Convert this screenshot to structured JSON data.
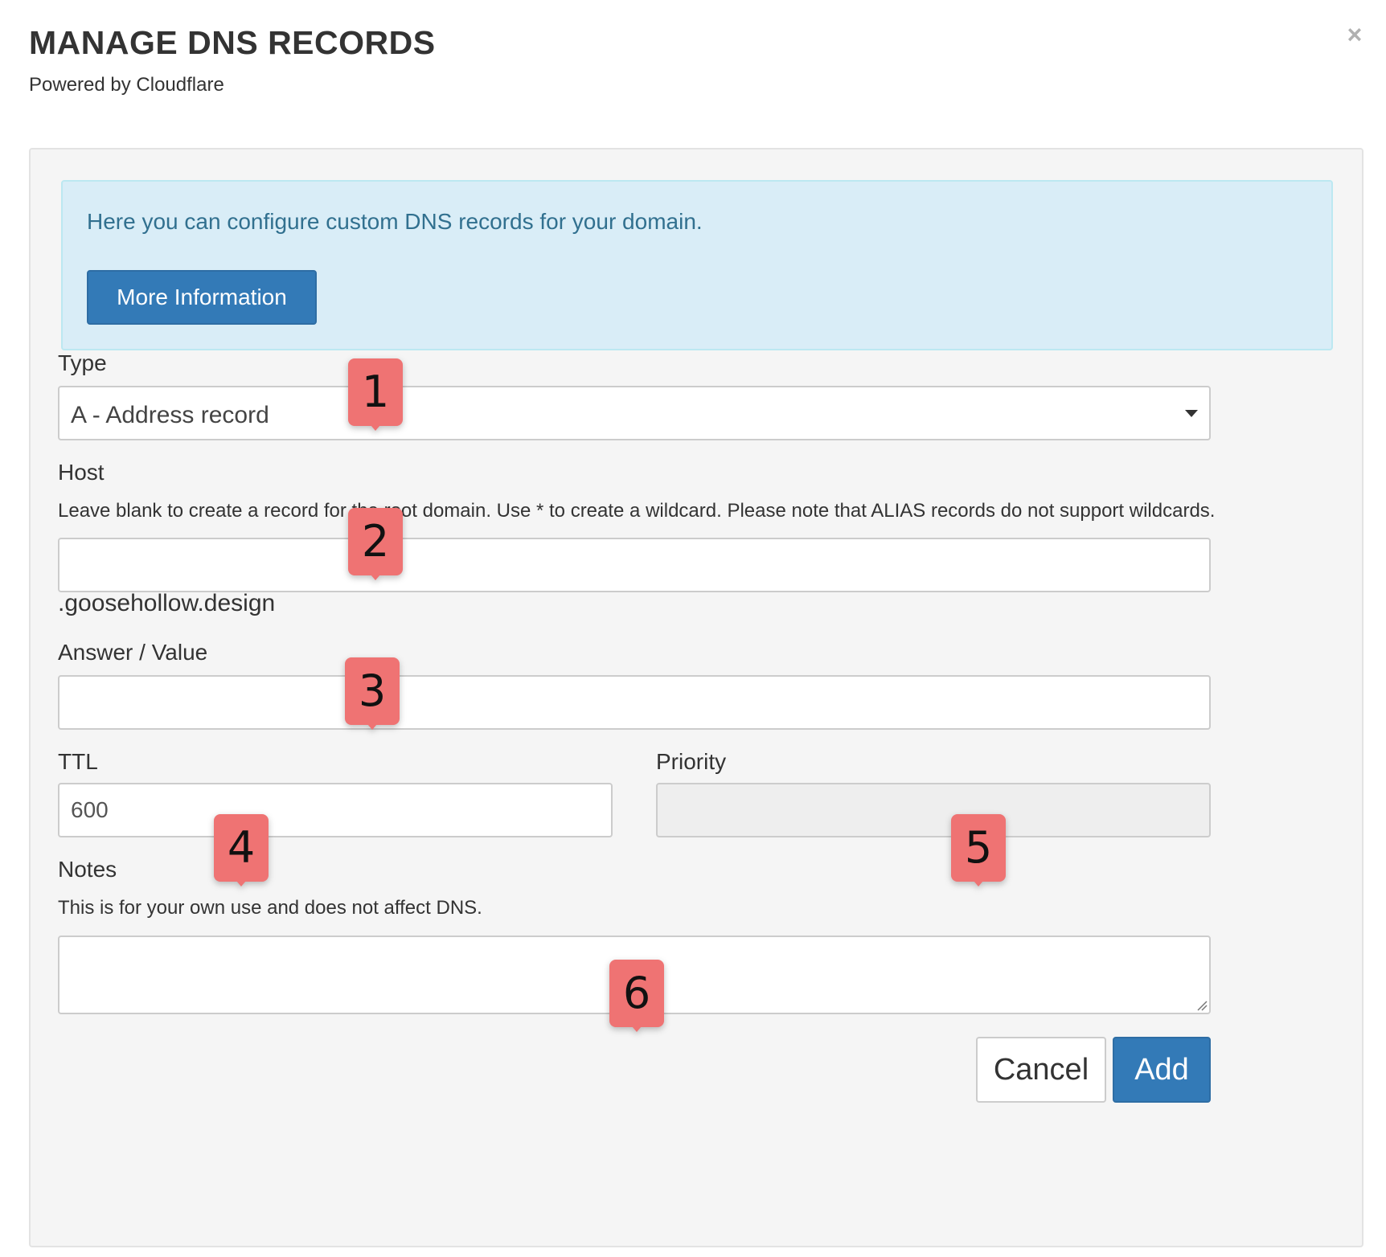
{
  "header": {
    "title": "MANAGE DNS RECORDS",
    "subtitle": "Powered by Cloudflare",
    "close_symbol": "×"
  },
  "info": {
    "text": "Here you can configure custom DNS records for your domain.",
    "button_label": "More Information"
  },
  "form": {
    "type": {
      "label": "Type",
      "selected": "A - Address record"
    },
    "host": {
      "label": "Host",
      "help": "Leave blank to create a record for the root domain. Use * to create a wildcard. Please note that ALIAS records do not support wildcards.",
      "value": "",
      "suffix": ".goosehollow.design"
    },
    "answer": {
      "label": "Answer / Value",
      "value": ""
    },
    "ttl": {
      "label": "TTL",
      "value": "600"
    },
    "priority": {
      "label": "Priority",
      "value": ""
    },
    "notes": {
      "label": "Notes",
      "help": "This is for your own use and does not affect DNS.",
      "value": ""
    }
  },
  "footer": {
    "cancel_label": "Cancel",
    "add_label": "Add"
  },
  "markers": [
    "1",
    "2",
    "3",
    "4",
    "5",
    "6"
  ],
  "colors": {
    "marker": "#ef7373",
    "primary": "#337ab7",
    "info_bg": "#d9edf7",
    "info_text": "#31708f",
    "panel_bg": "#f5f5f5"
  }
}
